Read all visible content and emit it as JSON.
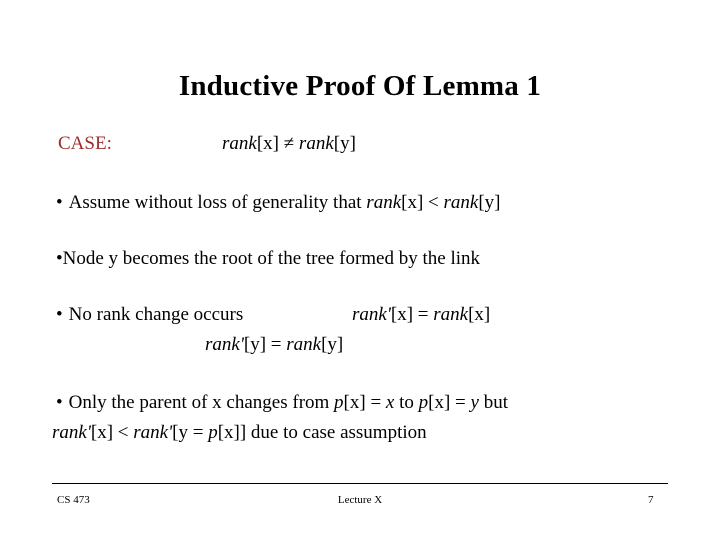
{
  "slide": {
    "title": "Inductive Proof Of Lemma 1",
    "case": {
      "label": "CASE:",
      "label_color": "#9E2B2B",
      "expression_prefix": "rank",
      "expression_mid": "[x] ≠ ",
      "expression_suffix": "rank",
      "expression_end": "[y]",
      "full_expression": "rank[x] ≠ rank[y]"
    },
    "bullets": [
      {
        "marker": "•",
        "text_before": "Assume without loss of generality that ",
        "math_1": "rank",
        "mid_1": "[x] < ",
        "math_2": "rank",
        "mid_2": "[y]",
        "full_text": "• Assume without loss of generality that rank[x] < rank[y]"
      },
      {
        "marker": "•",
        "text_before": "Node y becomes the root of the tree formed by the link",
        "full_text": "•Node y becomes the root of the tree formed by the link"
      },
      {
        "marker": "•",
        "text_before": "No rank change occurs",
        "expr_line_1_m1": "rank'",
        "expr_line_1_mid": "[x] = ",
        "expr_line_1_m2": "rank",
        "expr_line_1_end": "[x]",
        "expr_line_1_full": "rank'[x] = rank[x]",
        "expr_line_2_m1": "rank'",
        "expr_line_2_mid": "[y] = ",
        "expr_line_2_m2": "rank",
        "expr_line_2_end": "[y]",
        "expr_line_2_full": "rank'[y] = rank[y]",
        "full_text": "• No rank change occurs"
      },
      {
        "marker": "•",
        "text_before": "Only the parent of x changes from ",
        "m1": "p",
        "mid1": "[x] = ",
        "m2": "x",
        "mid2": " to ",
        "m3": "p",
        "mid3": "[x] = ",
        "m4": "y",
        "mid4": " but",
        "line2_m1": "rank'",
        "line2_mid1": "[x] < ",
        "line2_m2": "rank'",
        "line2_mid2": "[y = ",
        "line2_m3": "p",
        "line2_mid3": "[x]] due to case assumption",
        "full_text": "• Only the parent of x changes from p[x] = x to p[x] = y but rank'[x] < rank'[y = p[x]] due to case assumption"
      }
    ]
  },
  "footer": {
    "course": "CS 473",
    "lecture": "Lecture X",
    "page_number": "7"
  }
}
